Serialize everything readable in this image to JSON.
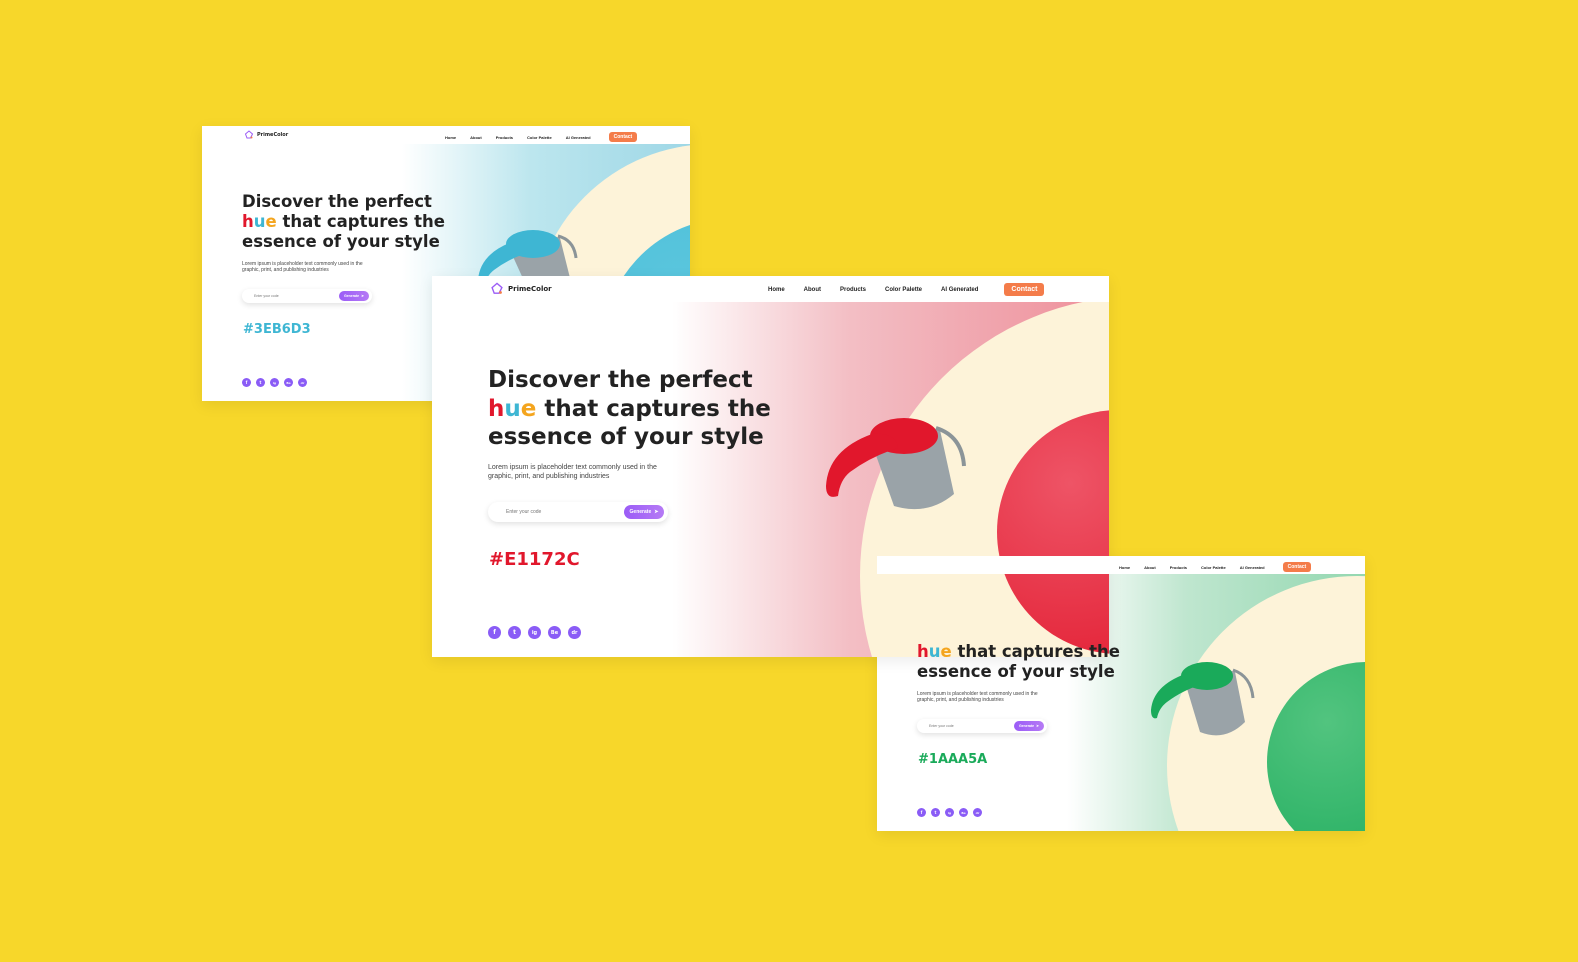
{
  "brand": {
    "name": "PrimeColor"
  },
  "nav": {
    "links": [
      "Home",
      "About",
      "Products",
      "Color Palette",
      "AI Generated"
    ],
    "contact_label": "Contact"
  },
  "hero": {
    "headline_line1": "Discover the perfect",
    "headline_h": "h",
    "headline_u": "u",
    "headline_e": "e",
    "headline_rest2": " that captures the",
    "headline_line3": "essence of your style",
    "description_line1": "Lorem ipsum is placeholder text commonly used in the",
    "description_line2": "graphic, print, and publishing industries",
    "search_placeholder": "Enter your code",
    "generate_label": "Generate"
  },
  "variants": [
    {
      "hex": "#3EB6D3",
      "color": "#3EB6D3"
    },
    {
      "hex": "#E1172C",
      "color": "#E1172C"
    },
    {
      "hex": "#1AAA5A",
      "color": "#1AAA5A"
    }
  ],
  "socials": [
    "f",
    "t",
    "ig",
    "Be",
    "dr"
  ],
  "colors": {
    "background": "#F7D72A",
    "contact": "#F47C4A",
    "purple": "#8A5CF6",
    "cream": "#FDF3D9"
  }
}
